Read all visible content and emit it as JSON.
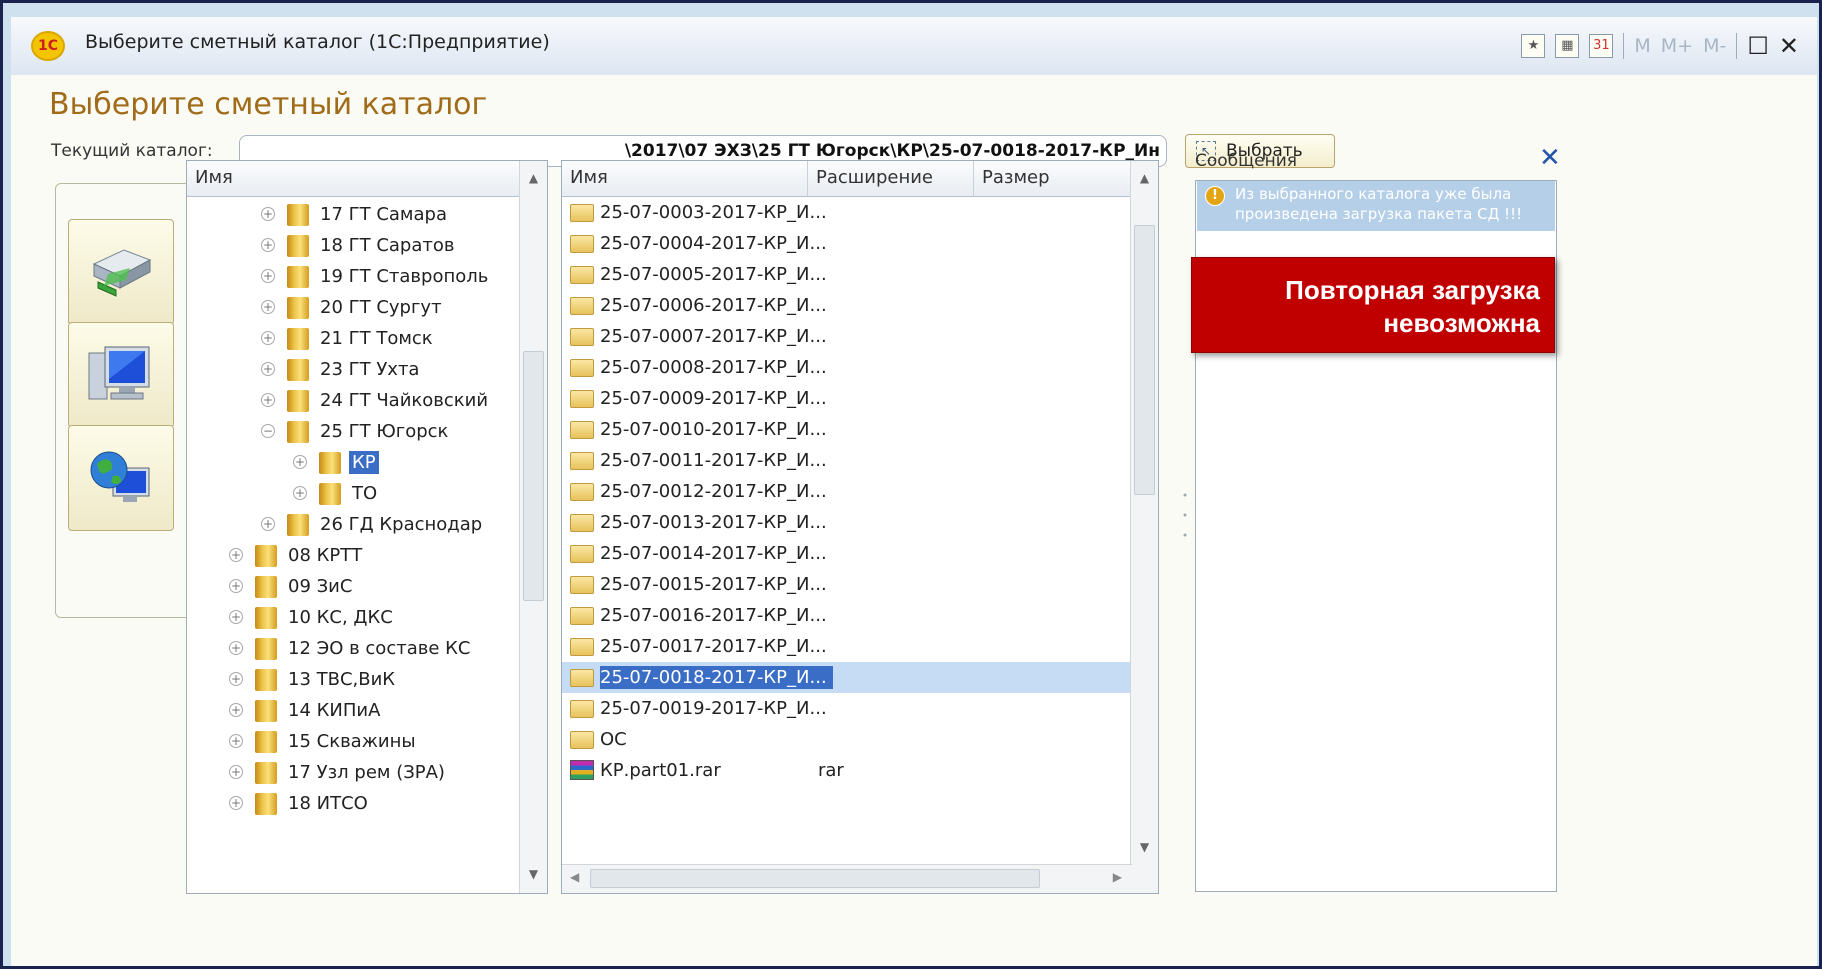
{
  "window": {
    "logo_text": "1С",
    "title": "Выберите сметный каталог  (1С:Предприятие)",
    "toolbar": [
      "M",
      "M+",
      "M-"
    ]
  },
  "dialog": {
    "heading": "Выберите сметный каталог",
    "path_label": "Текущий каталог:",
    "path_value": "\\2017\\07 ЭХЗ\\25 ГТ Югорск\\КР\\25-07-0018-2017-КР_Ин",
    "select_button": "Выбрать"
  },
  "tree": {
    "header": "Имя",
    "rows": [
      {
        "label": "17 ГТ Самара",
        "level": 2,
        "state": "collapsed"
      },
      {
        "label": "18 ГТ Саратов",
        "level": 2,
        "state": "collapsed"
      },
      {
        "label": "19 ГТ Ставрополь",
        "level": 2,
        "state": "collapsed"
      },
      {
        "label": "20 ГТ Сургут",
        "level": 2,
        "state": "collapsed"
      },
      {
        "label": "21 ГТ Томск",
        "level": 2,
        "state": "collapsed"
      },
      {
        "label": "23 ГТ Ухта",
        "level": 2,
        "state": "collapsed"
      },
      {
        "label": "24 ГТ Чайковский",
        "level": 2,
        "state": "collapsed"
      },
      {
        "label": "25 ГТ Югорск",
        "level": 2,
        "state": "expanded"
      },
      {
        "label": "КР",
        "level": 3,
        "state": "collapsed",
        "selected": true
      },
      {
        "label": "ТО",
        "level": 3,
        "state": "collapsed"
      },
      {
        "label": "26 ГД Краснодар",
        "level": 2,
        "state": "collapsed"
      },
      {
        "label": "08 КРТТ",
        "level": 1,
        "state": "collapsed"
      },
      {
        "label": "09 ЗиС",
        "level": 1,
        "state": "collapsed"
      },
      {
        "label": "10 КС, ДКС",
        "level": 1,
        "state": "collapsed"
      },
      {
        "label": "12 ЭО в составе КС",
        "level": 1,
        "state": "collapsed"
      },
      {
        "label": "13 ТВС,ВиК",
        "level": 1,
        "state": "collapsed"
      },
      {
        "label": "14 КИПиА",
        "level": 1,
        "state": "collapsed"
      },
      {
        "label": "15 Скважины",
        "level": 1,
        "state": "collapsed"
      },
      {
        "label": "17 Узл рем (ЗРА)",
        "level": 1,
        "state": "collapsed"
      },
      {
        "label": "18 ИТСО",
        "level": 1,
        "state": "collapsed"
      }
    ]
  },
  "files": {
    "headers": [
      "Имя",
      "Расширение",
      "Размер"
    ],
    "rows": [
      {
        "name": "25-07-0003-2017-КР_И...",
        "ext": "",
        "size": "",
        "icon": "folder-icon"
      },
      {
        "name": "25-07-0004-2017-КР_И...",
        "ext": "",
        "size": "",
        "icon": "folder-icon"
      },
      {
        "name": "25-07-0005-2017-КР_И...",
        "ext": "",
        "size": "",
        "icon": "folder-icon"
      },
      {
        "name": "25-07-0006-2017-КР_И...",
        "ext": "",
        "size": "",
        "icon": "folder-icon"
      },
      {
        "name": "25-07-0007-2017-КР_И...",
        "ext": "",
        "size": "",
        "icon": "folder-icon"
      },
      {
        "name": "25-07-0008-2017-КР_И...",
        "ext": "",
        "size": "",
        "icon": "folder-icon"
      },
      {
        "name": "25-07-0009-2017-КР_И...",
        "ext": "",
        "size": "",
        "icon": "folder-icon"
      },
      {
        "name": "25-07-0010-2017-КР_И...",
        "ext": "",
        "size": "",
        "icon": "folder-icon"
      },
      {
        "name": "25-07-0011-2017-КР_И...",
        "ext": "",
        "size": "",
        "icon": "folder-icon"
      },
      {
        "name": "25-07-0012-2017-КР_И...",
        "ext": "",
        "size": "",
        "icon": "folder-icon"
      },
      {
        "name": "25-07-0013-2017-КР_И...",
        "ext": "",
        "size": "",
        "icon": "folder-icon"
      },
      {
        "name": "25-07-0014-2017-КР_И...",
        "ext": "",
        "size": "",
        "icon": "folder-icon"
      },
      {
        "name": "25-07-0015-2017-КР_И...",
        "ext": "",
        "size": "",
        "icon": "folder-icon"
      },
      {
        "name": "25-07-0016-2017-КР_И...",
        "ext": "",
        "size": "",
        "icon": "folder-icon"
      },
      {
        "name": "25-07-0017-2017-КР_И...",
        "ext": "",
        "size": "",
        "icon": "folder-icon"
      },
      {
        "name": "25-07-0018-2017-КР_И...",
        "ext": "",
        "size": "",
        "icon": "folder-icon",
        "selected": true
      },
      {
        "name": "25-07-0019-2017-КР_И...",
        "ext": "",
        "size": "",
        "icon": "folder-icon"
      },
      {
        "name": "ОС",
        "ext": "",
        "size": "",
        "icon": "folder-icon"
      },
      {
        "name": "КР.part01.rar",
        "ext": "rar",
        "size": "",
        "icon": "rar-archive-icon"
      }
    ]
  },
  "messages": {
    "title": "Сообщения",
    "items": [
      {
        "text": "Из выбранного каталога уже была произведена загрузка пакета СД !!!",
        "icon": "warning-icon"
      }
    ]
  },
  "callout": {
    "line1": "Повторная загрузка",
    "line2": "невозможна",
    "color": "#c00000"
  },
  "colors": {
    "heading": "#a06c19",
    "selection": "#3a6ec6",
    "row_highlight": "#c5dcf4",
    "frame_border": "#1a2350"
  }
}
